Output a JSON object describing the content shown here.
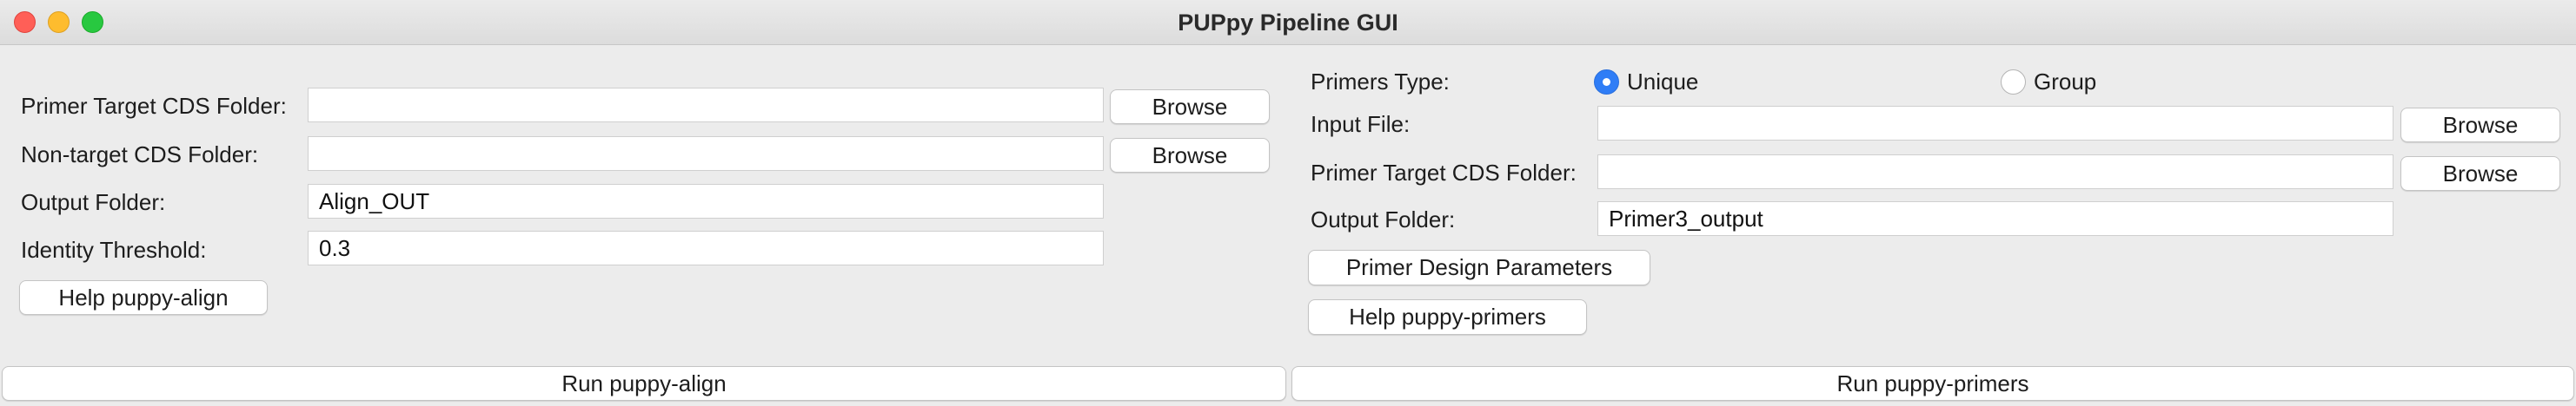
{
  "window": {
    "title": "PUPpy Pipeline GUI"
  },
  "align": {
    "target_label": "Primer Target CDS Folder:",
    "target_value": "",
    "nontarget_label": "Non-target CDS Folder:",
    "nontarget_value": "",
    "output_label": "Output Folder:",
    "output_value": "Align_OUT",
    "identity_label": "Identity Threshold:",
    "identity_value": "0.3",
    "browse_label": "Browse",
    "help_label": "Help puppy-align",
    "run_label": "Run puppy-align"
  },
  "primers": {
    "type_label": "Primers Type:",
    "type_options": [
      {
        "label": "Unique",
        "selected": true
      },
      {
        "label": "Group",
        "selected": false
      }
    ],
    "input_label": "Input File:",
    "input_value": "",
    "target_label": "Primer Target CDS Folder:",
    "target_value": "",
    "output_label": "Output Folder:",
    "output_value": "Primer3_output",
    "browse_label": "Browse",
    "params_label": "Primer Design Parameters",
    "help_label": "Help puppy-primers",
    "run_label": "Run puppy-primers"
  },
  "colors": {
    "accent": "#2f7df6",
    "close": "#ff5f57",
    "minimize": "#febc2e",
    "maximize": "#28c840"
  }
}
